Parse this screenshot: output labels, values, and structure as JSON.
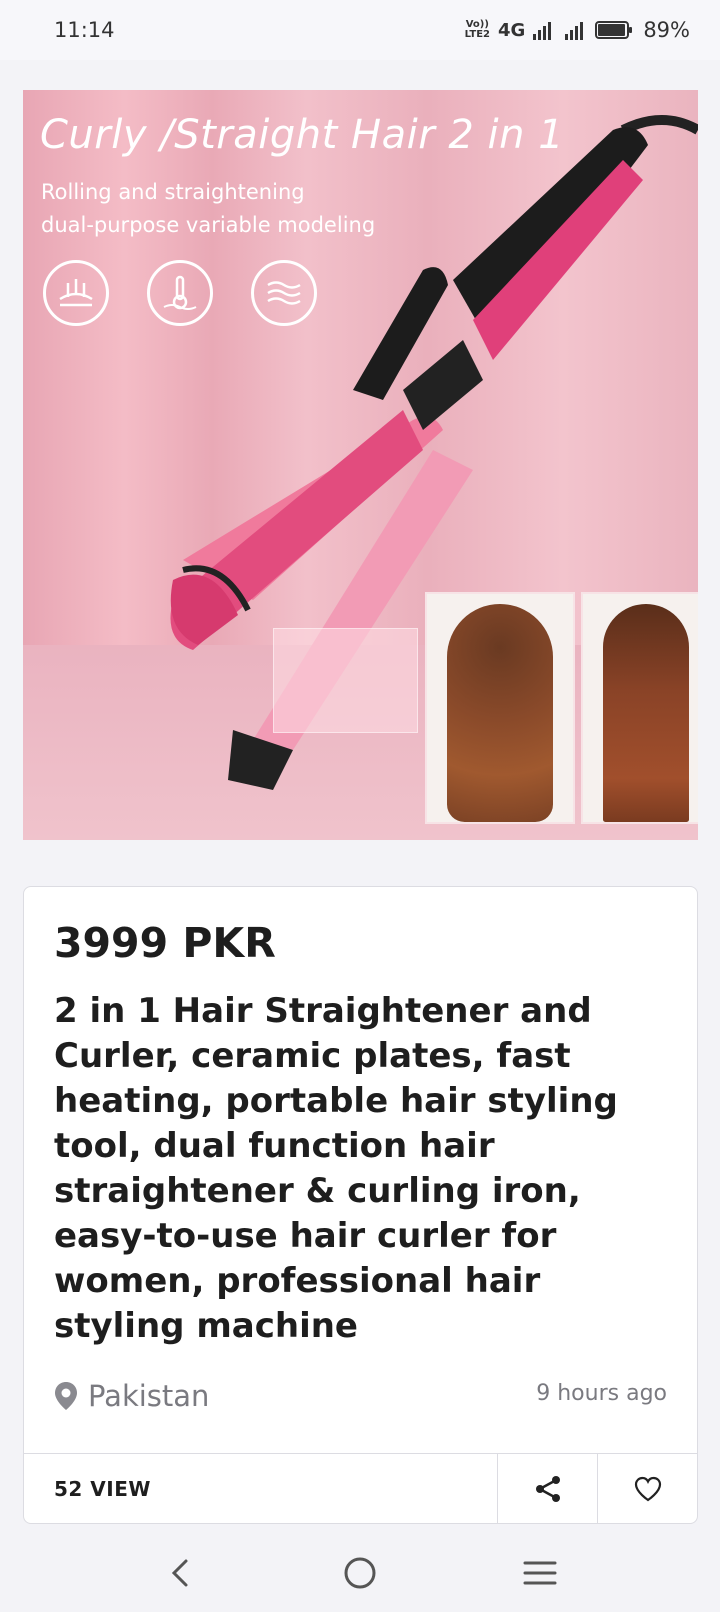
{
  "status_bar": {
    "time": "11:14",
    "volte_top": "Vo))",
    "volte_bottom": "LTE2",
    "network": "4G",
    "battery": "89%"
  },
  "product_image": {
    "headline": "Curly /Straight Hair 2 in 1",
    "subline_1": "Rolling and straightening",
    "subline_2": "dual-purpose variable modeling"
  },
  "listing": {
    "price": "3999 PKR",
    "title": "2 in 1 Hair Straightener and Curler, ceramic plates, fast heating, portable hair styling tool, dual function hair straightener & curling iron, easy-to-use hair curler for women, professional hair styling machine",
    "location": "Pakistan",
    "posted": "9 hours ago",
    "views": "52 VIEW"
  },
  "icons": {
    "location": "location-pin-icon",
    "share": "share-icon",
    "favorite": "heart-icon",
    "nav_back": "chevron-left-icon",
    "nav_home": "circle-home-icon",
    "nav_menu": "hamburger-menu-icon"
  },
  "colors": {
    "accent_pink": "#e9467a",
    "text_primary": "#1e1e1e",
    "text_secondary": "#7a7a80"
  }
}
